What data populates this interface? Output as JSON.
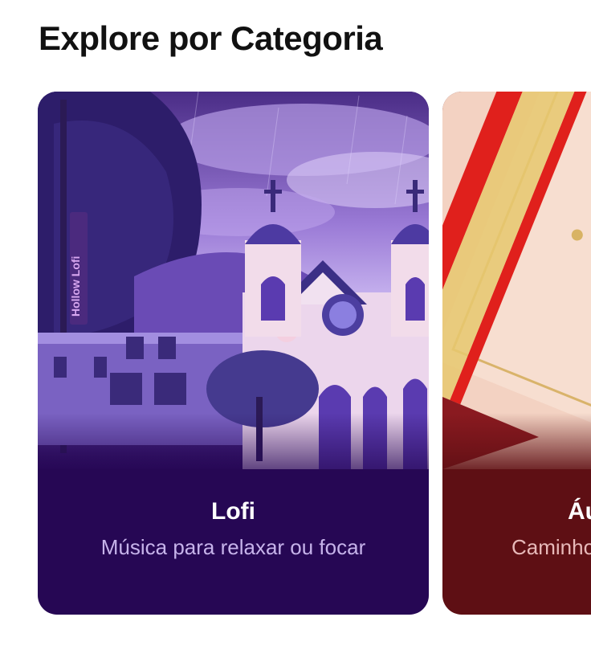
{
  "section": {
    "title": "Explore por Categoria"
  },
  "categories": [
    {
      "title": "Lofi",
      "subtitle": "Música para relaxar ou focar",
      "colors": {
        "background": "#260754",
        "accent": "#7b4fc9"
      },
      "banner_text": "Hollow Lofi"
    },
    {
      "title": "Áu",
      "subtitle": "Caminho",
      "colors": {
        "background": "#5e0f14",
        "accent": "#e0201c"
      }
    }
  ]
}
